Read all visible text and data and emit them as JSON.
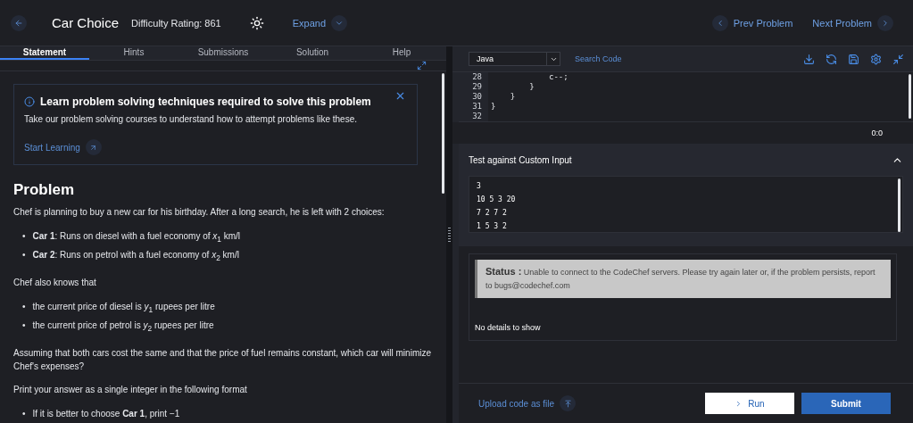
{
  "header": {
    "title": "Car Choice",
    "difficulty": "Difficulty Rating: 861",
    "expand": "Expand",
    "prev": "Prev Problem",
    "next": "Next Problem"
  },
  "tabs": [
    {
      "label": "Statement",
      "selected": true
    },
    {
      "label": "Hints",
      "selected": false
    },
    {
      "label": "Submissions",
      "selected": false
    },
    {
      "label": "Solution",
      "selected": false
    },
    {
      "label": "Help",
      "selected": false
    }
  ],
  "banner": {
    "title": "Learn problem solving techniques required to solve this problem",
    "text": "Take our problem solving courses to understand how to attempt problems like these.",
    "link": "Start Learning"
  },
  "problem": {
    "heading": "Problem",
    "blocks": [
      {
        "kind": "para",
        "text": "Chef is planning to buy a new car for his birthday. After a long search, he is left with 2 choices:"
      },
      {
        "kind": "list",
        "bullet": "•",
        "items": [
          "**Car 1**: Runs on diesel with a fuel economy of *x*$_{1}$ km/l",
          "**Car 2**: Runs on petrol with a fuel economy of *x*$_{2}$ km/l"
        ]
      },
      {
        "kind": "para",
        "text": "Chef also knows that"
      },
      {
        "kind": "list",
        "bullet": "•",
        "items": [
          "the current price of diesel is *y*$_{1}$ rupees per litre",
          "the current price of petrol is *y*$_{2}$ rupees per litre"
        ]
      },
      {
        "kind": "para",
        "text": "Assuming that both cars cost the same and that the price of fuel remains constant, which car will minimize Chef's expenses?"
      },
      {
        "kind": "para",
        "text": "Print your answer as a single integer in the following format"
      },
      {
        "kind": "list",
        "bullet": "•",
        "items": [
          "If it is better to choose **Car 1**, print −1"
        ]
      }
    ]
  },
  "editor": {
    "language": "Java",
    "search": "Search Code",
    "lines": [
      {
        "number": "28",
        "code": "            c--;"
      },
      {
        "number": "29",
        "code": "        }"
      },
      {
        "number": "30",
        "code": "    }"
      },
      {
        "number": "31",
        "code": "}"
      },
      {
        "number": "32"
      }
    ],
    "cursor": "0:0"
  },
  "custom_input": {
    "title": "Test against Custom Input",
    "expanded": true,
    "lines": [
      "3",
      "10 5 3 20",
      "7 2 7 2",
      "1 5 3 2"
    ]
  },
  "status": {
    "label": "Status :",
    "message": "Unable to connect to the CodeChef servers. Please try again later or, if the problem persists, report to bugs@codechef.com",
    "details": "No details to show"
  },
  "footer": {
    "upload": "Upload code as file",
    "run": "Run",
    "submit": "Submit"
  }
}
